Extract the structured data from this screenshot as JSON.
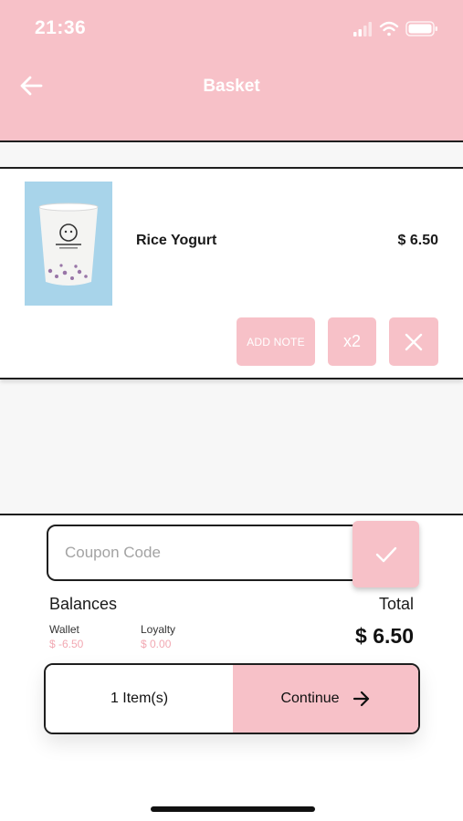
{
  "status_bar": {
    "time": "21:36",
    "icons": [
      "signal-icon",
      "wifi-icon",
      "battery-icon"
    ]
  },
  "header": {
    "title": "Basket",
    "back_icon": "arrow-left-icon"
  },
  "colors": {
    "accent": "#f7c1c8",
    "balance_value": "#f2a8b2",
    "product_bg": "#a8d4ea"
  },
  "basket": {
    "items": [
      {
        "name": "Rice Yogurt",
        "price": "$ 6.50",
        "image": "rice-yogurt-cup",
        "add_note_label": "ADD NOTE",
        "quantity_label": "x2",
        "remove_icon": "close-icon"
      }
    ]
  },
  "coupon": {
    "placeholder": "Coupon Code",
    "value": "",
    "apply_icon": "checkmark-icon"
  },
  "balances": {
    "title": "Balances",
    "wallet_label": "Wallet",
    "wallet_value": "$ -6.50",
    "loyalty_label": "Loyalty",
    "loyalty_value": "$ 0.00"
  },
  "total": {
    "label": "Total",
    "value": "$ 6.50"
  },
  "checkout": {
    "item_count": "1 Item(s)",
    "continue_label": "Continue",
    "continue_icon": "arrow-right-icon"
  }
}
